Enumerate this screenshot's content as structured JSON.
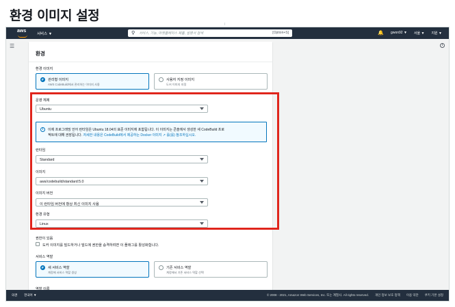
{
  "page_heading": "환경 이미지 설정",
  "topnav": {
    "logo": "aws",
    "services": "서비스 ▼",
    "search_placeholder": "서비스, 기능, 마켓플레이스 제품, 설명서 검색",
    "search_shortcut": "[Option+S]",
    "bell_icon": "bell-icon",
    "user": "gwon92 ▼",
    "region": "서울 ▼",
    "support": "지원 ▼"
  },
  "panel": {
    "title": "환경",
    "env_image_label": "환경 이미지",
    "managed_image_title": "관리형 이미지",
    "managed_image_desc": "AWS CodeBuild에서 관리하는 이미지 사용",
    "custom_image_title": "사용자 지정 이미지",
    "custom_image_desc": "도커 이미지 지정",
    "os_label": "운영 체제",
    "os_value": "Ubuntu",
    "info_line1": "이제 프로그래밍 언어 런타임은 Ubuntu 18.04의 표준 이미지에 포함됩니다. 이 이미지는 콘솔에서 생성한 새 CodeBuild 프로",
    "info_line2_text": "젝트에 대해 권장됩니다.",
    "info_line2_link": "자세한 내용은 CodeBuild에서 제공하는 Docker 이미지 ↗ 를(를) 참조하십시오.",
    "runtime_label": "런타임",
    "runtime_value": "Standard",
    "image_label": "이미지",
    "image_value": "aws/codebuild/standard:5.0",
    "image_version_label": "이미지 버전",
    "image_version_value": "이 런타임 버전에 항상 최신 이미지 사용",
    "env_type_label": "환경 유형",
    "env_type_value": "Linux",
    "privileged_label": "권한이 있음",
    "privileged_desc": "도커 이미지를 빌드하거나 빌드에 권한을 승격하려면 이 플래그를 활성화합니다.",
    "service_role_label": "서비스 역할",
    "new_role_title": "새 서비스 역할",
    "new_role_desc": "계정에 서비스 역할 생성",
    "existing_role_title": "기존 서비스 역할",
    "existing_role_desc": "계정에서 기존 서비스 역할 선택",
    "role_name_label": "역할 이름"
  },
  "footer": {
    "feedback": "의견",
    "language": "한국어 ▼",
    "copyright": "© 2008 - 2021, Amazon Web Services, Inc. 또는 계열사. All rights reserved.",
    "privacy": "개인 정보 보호 정책",
    "terms": "이용 약관",
    "cookies": "쿠키 기본 설정"
  },
  "colors": {
    "nav_bg": "#232f3e",
    "accent": "#0073bb",
    "highlight_border": "#e0251c",
    "logo_smile": "#ff9900"
  }
}
